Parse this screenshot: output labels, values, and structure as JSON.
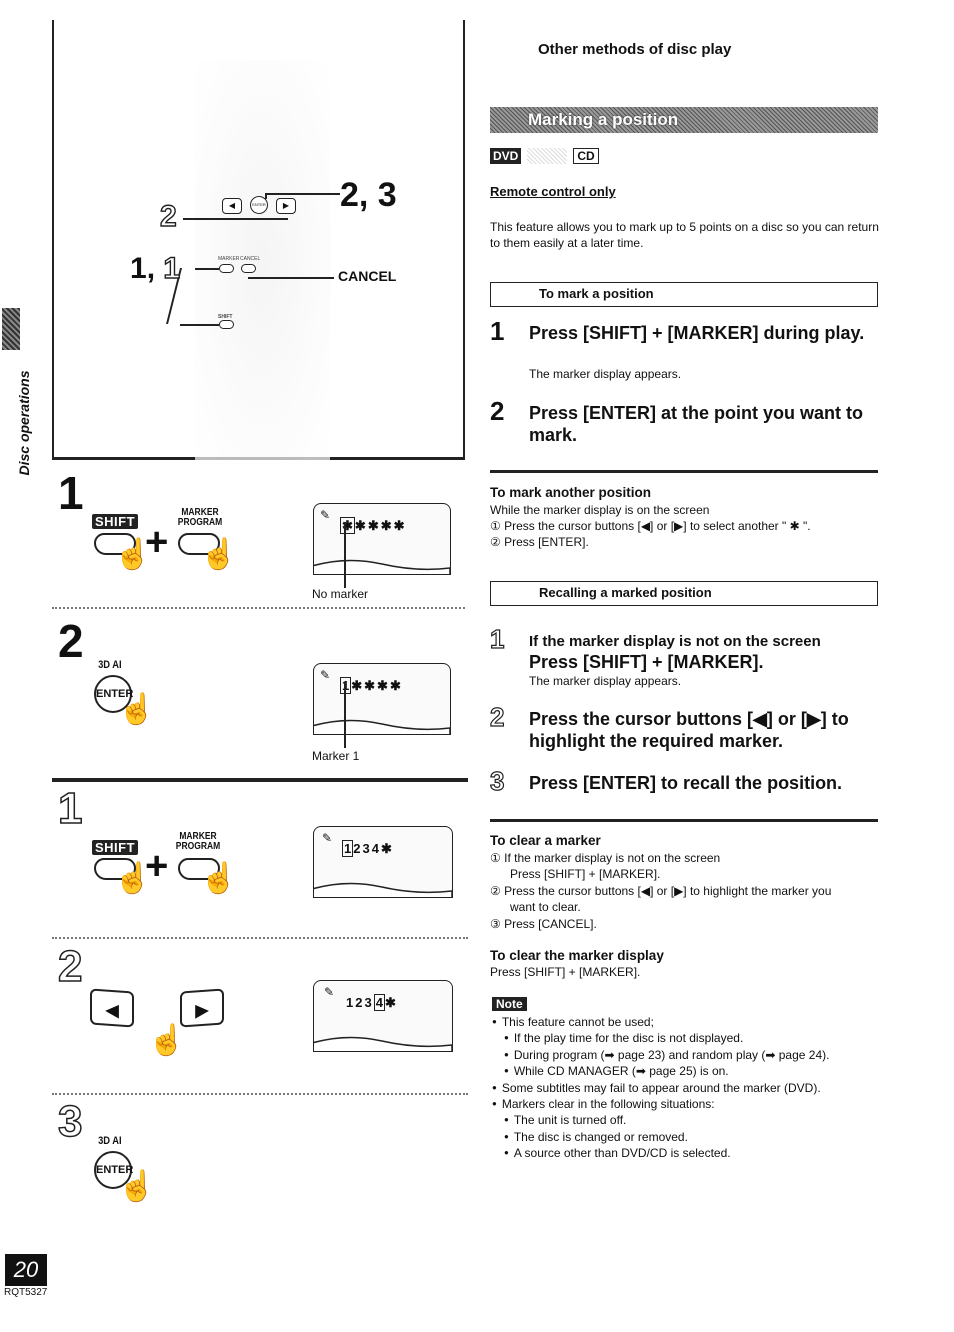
{
  "section_header": "Other methods of disc play",
  "side_tab": {
    "label": "Disc operations"
  },
  "page": {
    "number": "20",
    "code": "RQT5327"
  },
  "remote_diagram": {
    "callout_right": "2, 3",
    "callout_left_2": "2",
    "callout_1_bold": "1",
    "callout_1_sep": ",",
    "callout_1_outline": "1",
    "cancel_label": "CANCEL",
    "enter_tiny": "ENTER",
    "marker_tiny": "MARKER",
    "cancel_tiny": "CANCEL",
    "shift_tiny": "SHIFT"
  },
  "illustrations": {
    "mark": [
      {
        "step": "1",
        "shift_label": "SHIFT",
        "plus": "+",
        "marker_label_1": "MARKER",
        "marker_label_2": "PROGRAM",
        "screen_markers": [
          "*",
          "*",
          "*",
          "*",
          "*"
        ],
        "highlighted_index": 0,
        "screen_caption": "No marker"
      },
      {
        "step": "2",
        "key_caption": "3D AI",
        "key_label": "ENTER",
        "screen_markers": [
          "1",
          "*",
          "*",
          "*",
          "*"
        ],
        "highlighted_index": 0,
        "screen_caption": "Marker 1"
      }
    ],
    "recall": [
      {
        "step": "1",
        "shift_label": "SHIFT",
        "plus": "+",
        "marker_label_1": "MARKER",
        "marker_label_2": "PROGRAM",
        "screen_markers": [
          "1",
          "2",
          "3",
          "4",
          "*"
        ],
        "highlighted_index": 0
      },
      {
        "step": "2",
        "left_arrow": "◀",
        "right_arrow": "▶",
        "screen_markers": [
          "1",
          "2",
          "3",
          "4",
          "*"
        ],
        "highlighted_index": 3
      },
      {
        "step": "3",
        "key_caption": "3D AI",
        "key_label": "ENTER"
      }
    ]
  },
  "main": {
    "banner_title": "Marking a position",
    "disc_types": {
      "dvd": "DVD",
      "cd": "CD"
    },
    "remote_only": "Remote control only",
    "intro": "This feature allows you to mark up to 5 points on a disc so you can return to them easily at a later time.",
    "mark_section": {
      "heading": "To mark a position",
      "steps": [
        {
          "num": "1",
          "text": "Press [SHIFT] + [MARKER] during play.",
          "sub": "The marker display appears."
        },
        {
          "num": "2",
          "text": "Press [ENTER] at the point you want to mark."
        }
      ]
    },
    "mark_another": {
      "heading": "To mark another position",
      "intro": "While the marker display is on the screen",
      "items": [
        "① Press the cursor buttons [◀] or [▶] to select another \" ✱ \".",
        "② Press [ENTER]."
      ]
    },
    "recall_section": {
      "heading": "Recalling a marked position",
      "steps": [
        {
          "num": "1",
          "pre": "If the marker display is not on the screen",
          "text": "Press [SHIFT] + [MARKER].",
          "sub": "The marker display appears."
        },
        {
          "num": "2",
          "text": "Press the cursor buttons [◀] or [▶] to highlight the required marker."
        },
        {
          "num": "3",
          "text": "Press [ENTER] to recall the position."
        }
      ]
    },
    "clear_marker": {
      "heading": "To clear a marker",
      "items": [
        {
          "n": "①",
          "line1": "If the marker display is not on the screen",
          "line2": "Press [SHIFT] + [MARKER]."
        },
        {
          "n": "②",
          "line1": "Press the cursor buttons [◀] or [▶] to highlight the marker you",
          "line2": "want to clear."
        },
        {
          "n": "③",
          "line1": "Press [CANCEL]."
        }
      ]
    },
    "clear_display": {
      "heading": "To clear the marker display",
      "text": "Press [SHIFT] + [MARKER]."
    },
    "note": {
      "label": "Note",
      "items": [
        {
          "level": 1,
          "text": "This feature cannot be used;"
        },
        {
          "level": 2,
          "text": "If the play time for the disc is not displayed."
        },
        {
          "level": 2,
          "text": "During program (➡ page 23) and random play (➡ page 24)."
        },
        {
          "level": 2,
          "text": "While CD MANAGER (➡ page 25) is on."
        },
        {
          "level": 1,
          "text": "Some subtitles may fail to appear around the marker (DVD)."
        },
        {
          "level": 1,
          "text": "Markers clear in the following situations:"
        },
        {
          "level": 2,
          "text": "The unit is turned off."
        },
        {
          "level": 2,
          "text": "The disc is changed or removed."
        },
        {
          "level": 2,
          "text": "A source other than DVD/CD is selected."
        }
      ]
    }
  }
}
